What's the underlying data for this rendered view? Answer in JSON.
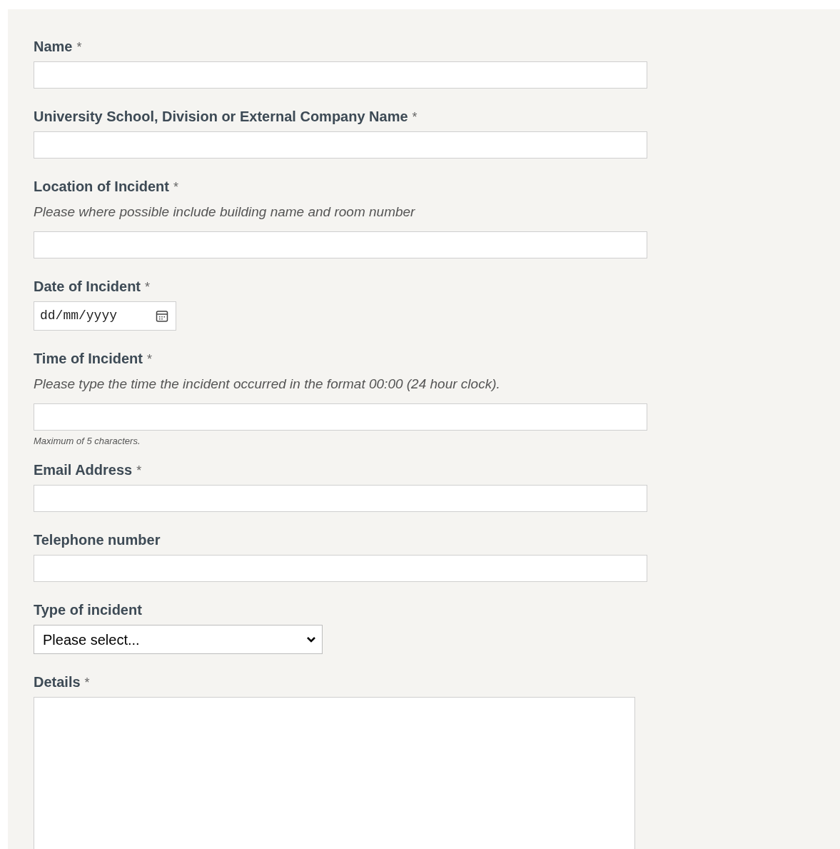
{
  "fields": [
    {
      "kind": "text",
      "label": "Name",
      "required_mark": "*"
    },
    {
      "kind": "text",
      "label": "University School, Division or External Company Name",
      "required_mark": "*"
    },
    {
      "kind": "text",
      "label": "Location of Incident",
      "required_mark": "*",
      "hint": "Please where possible include building name and room number"
    },
    {
      "kind": "date",
      "label": "Date of Incident",
      "required_mark": "*",
      "placeholder": "dd/mm/yyyy"
    },
    {
      "kind": "text",
      "label": "Time of Incident",
      "required_mark": "*",
      "hint": "Please type the time the incident occurred in the format 00:00 (24 hour clock).",
      "help": "Maximum of 5 characters."
    },
    {
      "kind": "text",
      "label": "Email Address",
      "required_mark": "*"
    },
    {
      "kind": "text",
      "label": "Telephone number"
    },
    {
      "kind": "select",
      "label": "Type of incident",
      "value": "Please select..."
    },
    {
      "kind": "textarea",
      "label": "Details",
      "required_mark": "*"
    }
  ]
}
